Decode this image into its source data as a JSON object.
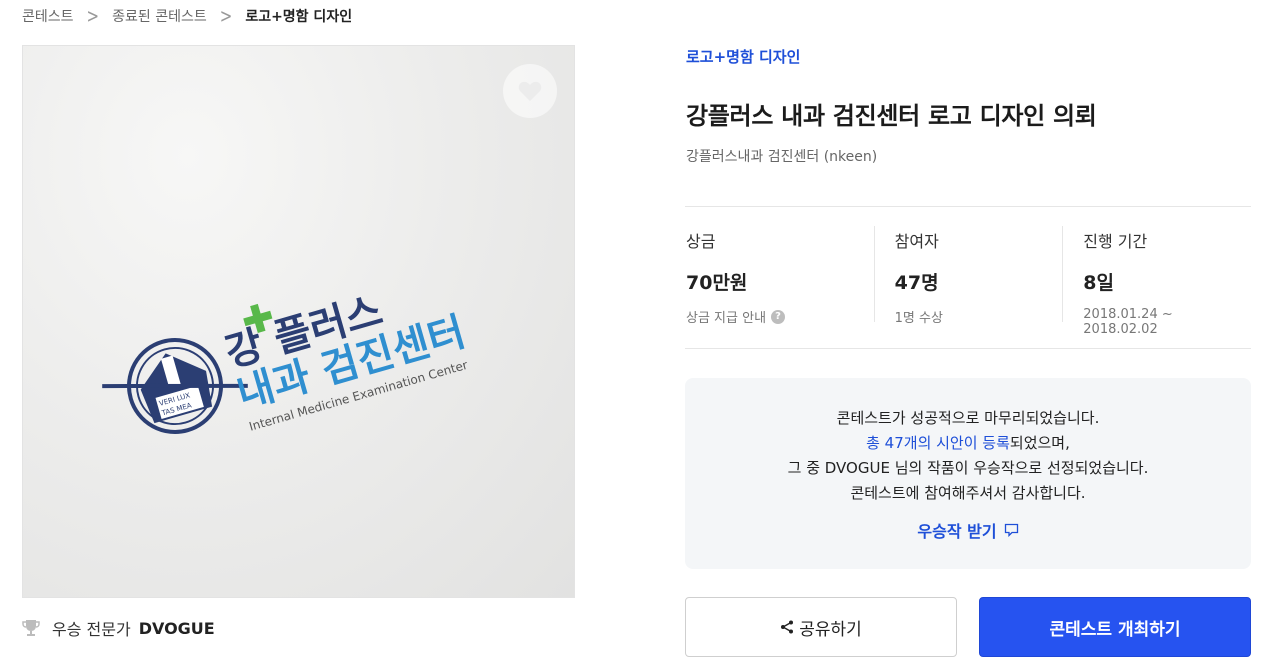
{
  "breadcrumb": {
    "items": [
      "콘테스트",
      "종료된 콘테스트",
      "로고+명함 디자인"
    ],
    "separator": ">"
  },
  "media": {
    "logo_text_line1": "강 플러스",
    "logo_text_line2": "내과 검진센터",
    "logo_subtext": "Internal Medicine Examination Center",
    "emblem_text_1": "VERI LUX",
    "emblem_text_2": "TAS MEA",
    "like_icon": "heart-icon"
  },
  "winner": {
    "prefix": "우승 전문가",
    "name": "DVOGUE"
  },
  "contest": {
    "category": "로고+명함 디자인",
    "title": "강플러스 내과 검진센터 로고 디자인 의뢰",
    "client": "강플러스내과 검진센터 (nkeen)"
  },
  "stats": [
    {
      "label": "상금",
      "value": "70만원",
      "sub": "상금 지급 안내",
      "has_help": true
    },
    {
      "label": "참여자",
      "value": "47명",
      "sub": "1명 수상",
      "has_help": false
    },
    {
      "label": "진행 기간",
      "value": "8일",
      "sub": "2018.01.24 ~ 2018.02.02",
      "has_help": false
    }
  ],
  "notice": {
    "line1": "콘테스트가 성공적으로 마무리되었습니다.",
    "line2_highlight": "총 47개의 시안이 등록",
    "line2_rest": "되었으며,",
    "line3": "그 중 DVOGUE 님의 작품이 우승작으로 선정되었습니다.",
    "line4": "콘테스트에 참여해주셔서 감사합니다.",
    "get_label": "우승작 받기"
  },
  "buttons": {
    "share": "공유하기",
    "host": "콘테스트 개최하기"
  },
  "colors": {
    "accent": "#1e4fd8",
    "primary_button": "#2653f0",
    "logo_navy": "#2b3e73",
    "logo_green": "#58b84a",
    "logo_blue": "#2f8fd0"
  }
}
